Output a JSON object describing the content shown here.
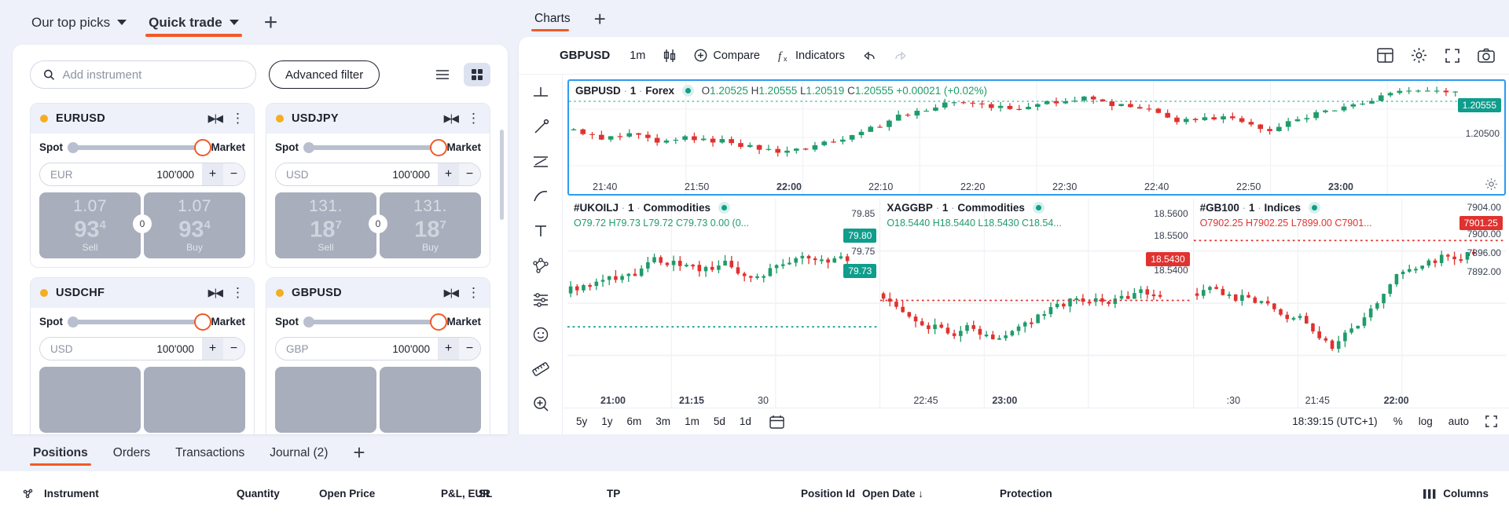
{
  "left_panel": {
    "tabs": [
      {
        "label": "Our top picks",
        "active": false,
        "caret": true
      },
      {
        "label": "Quick trade",
        "active": true,
        "caret": true
      }
    ],
    "add_tab_icon": "plus-icon",
    "search": {
      "placeholder": "Add instrument",
      "value": "",
      "icon": "search-icon"
    },
    "advanced_filter_label": "Advanced filter",
    "view_list_icon": "list-view-icon",
    "view_grid_icon": "grid-view-icon",
    "instruments": [
      {
        "symbol": "EURUSD",
        "status_color": "#f4ae22",
        "spot_label": "Spot",
        "market_label": "Market",
        "currency": "EUR",
        "quantity": "100'000",
        "plus_label": "+",
        "minus_label": "−",
        "sell": {
          "big": "1.07",
          "mid": "93",
          "sup": "4",
          "side": "Sell"
        },
        "buy": {
          "big": "1.07",
          "mid": "93",
          "sup": "4",
          "side": "Buy"
        },
        "spread": "0"
      },
      {
        "symbol": "USDJPY",
        "status_color": "#f4ae22",
        "spot_label": "Spot",
        "market_label": "Market",
        "currency": "USD",
        "quantity": "100'000",
        "plus_label": "+",
        "minus_label": "−",
        "sell": {
          "big": "131.",
          "mid": "18",
          "sup": "7",
          "side": "Sell"
        },
        "buy": {
          "big": "131.",
          "mid": "18",
          "sup": "7",
          "side": "Buy"
        },
        "spread": "0"
      },
      {
        "symbol": "USDCHF",
        "status_color": "#f4ae22",
        "spot_label": "Spot",
        "market_label": "Market",
        "currency": "USD",
        "quantity": "100'000",
        "plus_label": "+",
        "minus_label": "−",
        "sell": {
          "big": "",
          "mid": "",
          "sup": "",
          "side": ""
        },
        "buy": {
          "big": "",
          "mid": "",
          "sup": "",
          "side": ""
        },
        "spread": ""
      },
      {
        "symbol": "GBPUSD",
        "status_color": "#f4ae22",
        "spot_label": "Spot",
        "market_label": "Market",
        "currency": "GBP",
        "quantity": "100'000",
        "plus_label": "+",
        "minus_label": "−",
        "sell": {
          "big": "",
          "mid": "",
          "sup": "",
          "side": ""
        },
        "buy": {
          "big": "",
          "mid": "",
          "sup": "",
          "side": ""
        },
        "spread": ""
      }
    ]
  },
  "charts_panel": {
    "tabs": [
      {
        "label": "Charts",
        "active": true
      }
    ],
    "add_tab_icon": "plus-icon",
    "toolbar": {
      "symbol": "GBPUSD",
      "interval": "1m",
      "candle_icon": "candlestick-icon",
      "compare_label": "Compare",
      "compare_icon": "plus-circle-icon",
      "indicators_label": "Indicators",
      "indicators_icon": "function-icon",
      "undo_icon": "undo-icon",
      "redo_icon": "redo-icon",
      "layout_icon": "layout-grid-icon",
      "settings_icon": "gear-icon",
      "fullscreen_icon": "fullscreen-icon",
      "snapshot_icon": "camera-icon"
    },
    "tool_rail": [
      "crosshair-icon",
      "trendline-icon",
      "fib-icon",
      "brush-icon",
      "text-icon",
      "pattern-icon",
      "forecast-icon",
      "emoji-icon",
      "measure-icon",
      "zoom-in-icon"
    ],
    "main_chart": {
      "symbol": "GBPUSD",
      "interval": "1",
      "market": "Forex",
      "status_dot": "#0f9d8c",
      "open_label": "O",
      "open": "1.20525",
      "high_label": "H",
      "high": "1.20555",
      "low_label": "L",
      "low": "1.20519",
      "close_label": "C",
      "close": "1.20555",
      "change": "+0.00021",
      "change_pct": "(+0.02%)",
      "current_price_tag": "1.20555",
      "price_labels": [
        "1.20500"
      ],
      "time_labels": [
        "21:40",
        "21:50",
        "22:00",
        "22:10",
        "22:20",
        "22:30",
        "22:40",
        "22:50",
        "23:00"
      ],
      "bold_time_labels": [
        "22:00",
        "23:00"
      ],
      "settings_icon": "gear-icon"
    },
    "sub_charts": [
      {
        "symbol": "#UKOILJ",
        "interval": "1",
        "market": "Commodities",
        "status_dot": "#0f9d8c",
        "ohlc": "O79.72 H79.73 L79.72 C79.73 0.00 (0...",
        "price_labels": [
          "79.85",
          "79.75"
        ],
        "tags": [
          {
            "text": "79.80",
            "type": "green"
          },
          {
            "text": "79.73",
            "type": "green"
          }
        ],
        "time_labels": [
          "21:00",
          "21:15",
          "30"
        ],
        "bold_time_labels": [
          "21:00",
          "21:15"
        ]
      },
      {
        "symbol": "XAGGBP",
        "interval": "1",
        "market": "Commodities",
        "status_dot": "#0f9d8c",
        "ohlc": "O18.5440 H18.5440 L18.5430 C18.54...",
        "price_labels": [
          "18.5600",
          "18.5500",
          "18.5400"
        ],
        "tags": [
          {
            "text": "18.5430",
            "type": "red"
          }
        ],
        "time_labels": [
          "22:45",
          "23:00"
        ],
        "bold_time_labels": [
          "23:00"
        ]
      },
      {
        "symbol": "#GB100",
        "interval": "1",
        "market": "Indices",
        "status_dot": "#0f9d8c",
        "ohlc": "O7902.25 H7902.25 L7899.00 C7901...",
        "price_labels": [
          "7904.00",
          "7900.00",
          "7896.00",
          "7892.00"
        ],
        "tags": [
          {
            "text": "7901.25",
            "type": "red"
          }
        ],
        "time_labels": [
          ":30",
          "21:45",
          "22:00"
        ],
        "bold_time_labels": [
          "22:00"
        ]
      }
    ],
    "footer": {
      "timeframes": [
        "5y",
        "1y",
        "6m",
        "3m",
        "1m",
        "5d",
        "1d"
      ],
      "calendar_icon": "calendar-icon",
      "clock": "18:39:15 (UTC+1)",
      "percent_label": "%",
      "log_label": "log",
      "auto_label": "auto",
      "expand_icon": "expand-icon"
    }
  },
  "bottom_panel": {
    "tabs": [
      {
        "label": "Positions",
        "active": true
      },
      {
        "label": "Orders",
        "active": false
      },
      {
        "label": "Transactions",
        "active": false
      },
      {
        "label": "Journal (2)",
        "active": false
      }
    ],
    "add_tab_icon": "plus-icon",
    "columns": [
      {
        "label": "Instrument",
        "icon": "sort-icon"
      },
      {
        "label": "Quantity"
      },
      {
        "label": "Open Price"
      },
      {
        "label": "P&L, EUR"
      },
      {
        "label": "SL"
      },
      {
        "label": "TP"
      },
      {
        "label": "Position Id"
      },
      {
        "label": "Open Date",
        "sort": "↓"
      },
      {
        "label": "Protection"
      }
    ],
    "columns_button": {
      "label": "Columns",
      "icon": "columns-icon"
    }
  },
  "colors": {
    "accent": "#f05a28",
    "up": "#1e9c6a",
    "down": "#e0322f",
    "teal": "#0f9d8c",
    "chart_border": "#2d9cf0",
    "bg": "#eef1fa"
  }
}
